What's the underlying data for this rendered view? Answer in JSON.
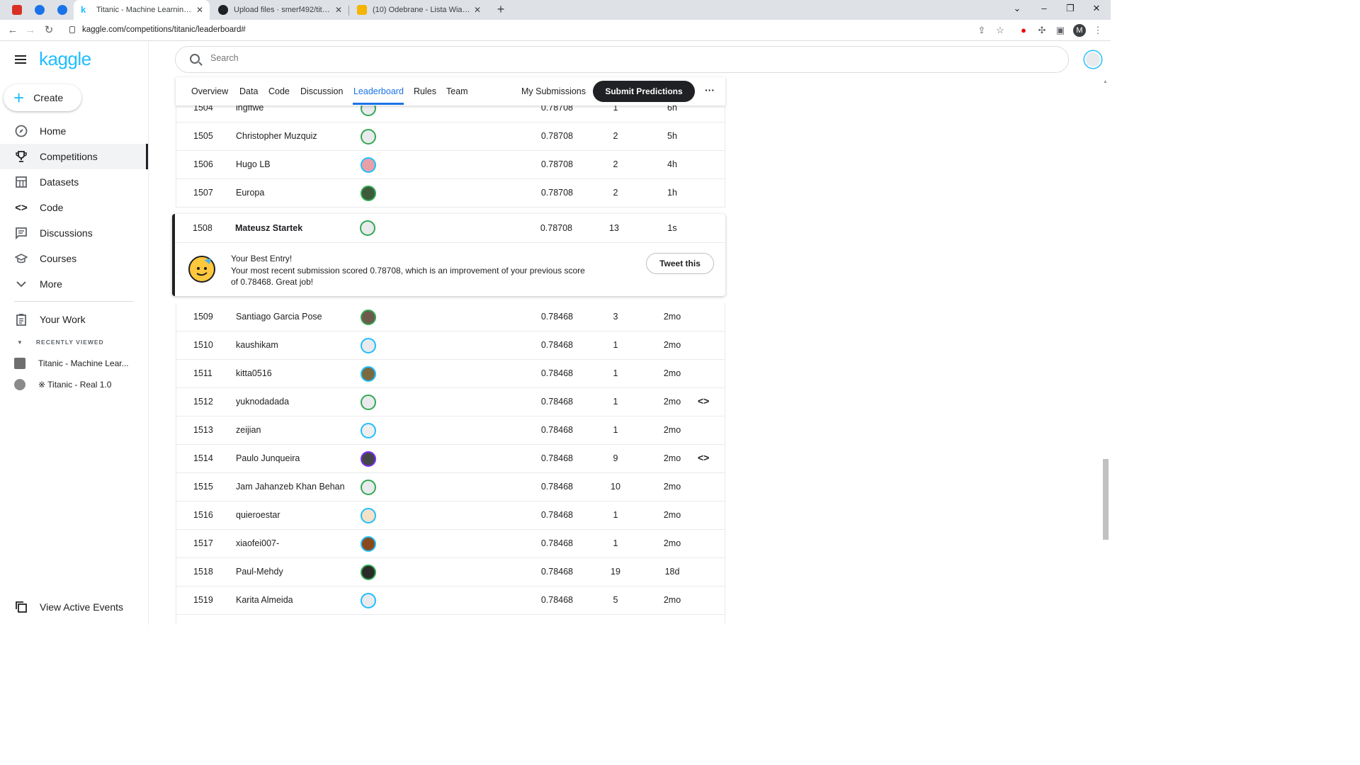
{
  "browser": {
    "tabs": [
      {
        "title": "",
        "pinned": true,
        "color": "#d93025"
      },
      {
        "title": "",
        "pinned": true,
        "color": "#1a73e8"
      },
      {
        "title": "",
        "pinned": true,
        "color": "#1a73e8"
      },
      {
        "title": "Titanic - Machine Learning from Di",
        "active": true,
        "color": "#20beff"
      },
      {
        "title": "Upload files · smerf492/titanic",
        "color": "#202124"
      },
      {
        "title": "(10) Odebrane - Lista Wiadomości",
        "color": "#f4b400"
      }
    ],
    "url": "kaggle.com/competitions/titanic/leaderboard#",
    "profile_initial": "M"
  },
  "sidebar": {
    "logo": "kaggle",
    "create_label": "Create",
    "items": [
      {
        "label": "Home",
        "icon": "compass-icon"
      },
      {
        "label": "Competitions",
        "icon": "trophy-icon",
        "active": true
      },
      {
        "label": "Datasets",
        "icon": "table-icon"
      },
      {
        "label": "Code",
        "icon": "code-icon"
      },
      {
        "label": "Discussions",
        "icon": "discussion-icon"
      },
      {
        "label": "Courses",
        "icon": "school-icon"
      },
      {
        "label": "More",
        "icon": "chevron-down-icon"
      }
    ],
    "your_work": "Your Work",
    "recently_viewed": "RECENTLY VIEWED",
    "recent": [
      {
        "label": "Titanic - Machine Lear..."
      },
      {
        "label": "※ Titanic - Real 1.0"
      }
    ],
    "view_active_events": "View Active Events"
  },
  "search": {
    "placeholder": "Search"
  },
  "comp_tabs": {
    "items": [
      "Overview",
      "Data",
      "Code",
      "Discussion",
      "Leaderboard",
      "Rules",
      "Team"
    ],
    "active": "Leaderboard",
    "my_submissions": "My Submissions",
    "submit": "Submit Predictions",
    "more": "···"
  },
  "leaderboard": {
    "rows_before": [
      {
        "rank": "1504",
        "team": "ingffwe",
        "score": "0.78708",
        "entries": "1",
        "last": "6h",
        "code": false,
        "ring": "#34a853",
        "fill": "#e8eaed"
      },
      {
        "rank": "1505",
        "team": "Christopher Muzquiz",
        "score": "0.78708",
        "entries": "2",
        "last": "5h",
        "code": false,
        "ring": "#34a853",
        "fill": "#e8eaed"
      },
      {
        "rank": "1506",
        "team": "Hugo LB",
        "score": "0.78708",
        "entries": "2",
        "last": "4h",
        "code": false,
        "ring": "#20beff",
        "fill": "#e8a0a8"
      },
      {
        "rank": "1507",
        "team": "Europa",
        "score": "0.78708",
        "entries": "2",
        "last": "1h",
        "code": false,
        "ring": "#34a853",
        "fill": "#3d5a3a"
      }
    ],
    "mine": {
      "rank": "1508",
      "team": "Mateusz Startek",
      "score": "0.78708",
      "entries": "13",
      "last": "1s"
    },
    "best_entry": {
      "title": "Your Best Entry!",
      "line1": "Your most recent submission scored 0.78708, which is an improvement of your previous score",
      "line2": "of 0.78468. Great job!",
      "tweet": "Tweet this"
    },
    "rows_after": [
      {
        "rank": "1509",
        "team": "Santiago Garcia Pose",
        "score": "0.78468",
        "entries": "3",
        "last": "2mo",
        "code": false,
        "ring": "#34a853",
        "fill": "#6d5a4a"
      },
      {
        "rank": "1510",
        "team": "kaushikam",
        "score": "0.78468",
        "entries": "1",
        "last": "2mo",
        "code": false,
        "ring": "#20beff",
        "fill": "#e8eaed"
      },
      {
        "rank": "1511",
        "team": "kitta0516",
        "score": "0.78468",
        "entries": "1",
        "last": "2mo",
        "code": false,
        "ring": "#20beff",
        "fill": "#7a6a40"
      },
      {
        "rank": "1512",
        "team": "yuknodadada",
        "score": "0.78468",
        "entries": "1",
        "last": "2mo",
        "code": true,
        "ring": "#34a853",
        "fill": "#e8eaed"
      },
      {
        "rank": "1513",
        "team": "zeijian",
        "score": "0.78468",
        "entries": "1",
        "last": "2mo",
        "code": false,
        "ring": "#20beff",
        "fill": "#eeeeee"
      },
      {
        "rank": "1514",
        "team": "Paulo Junqueira",
        "score": "0.78468",
        "entries": "9",
        "last": "2mo",
        "code": true,
        "ring": "#7b2ff7",
        "fill": "#44464a"
      },
      {
        "rank": "1515",
        "team": "Jam Jahanzeb Khan Behan",
        "score": "0.78468",
        "entries": "10",
        "last": "2mo",
        "code": false,
        "ring": "#34a853",
        "fill": "#e8eaed"
      },
      {
        "rank": "1516",
        "team": "quieroestar",
        "score": "0.78468",
        "entries": "1",
        "last": "2mo",
        "code": false,
        "ring": "#20beff",
        "fill": "#f3e2c8"
      },
      {
        "rank": "1517",
        "team": "xiaofei007-",
        "score": "0.78468",
        "entries": "1",
        "last": "2mo",
        "code": false,
        "ring": "#20beff",
        "fill": "#8a4a20"
      },
      {
        "rank": "1518",
        "team": "Paul-Mehdy",
        "score": "0.78468",
        "entries": "19",
        "last": "18d",
        "code": false,
        "ring": "#34a853",
        "fill": "#2a2a2a"
      },
      {
        "rank": "1519",
        "team": "Karita Almeida",
        "score": "0.78468",
        "entries": "5",
        "last": "2mo",
        "code": false,
        "ring": "#20beff",
        "fill": "#e8eaed"
      }
    ]
  }
}
